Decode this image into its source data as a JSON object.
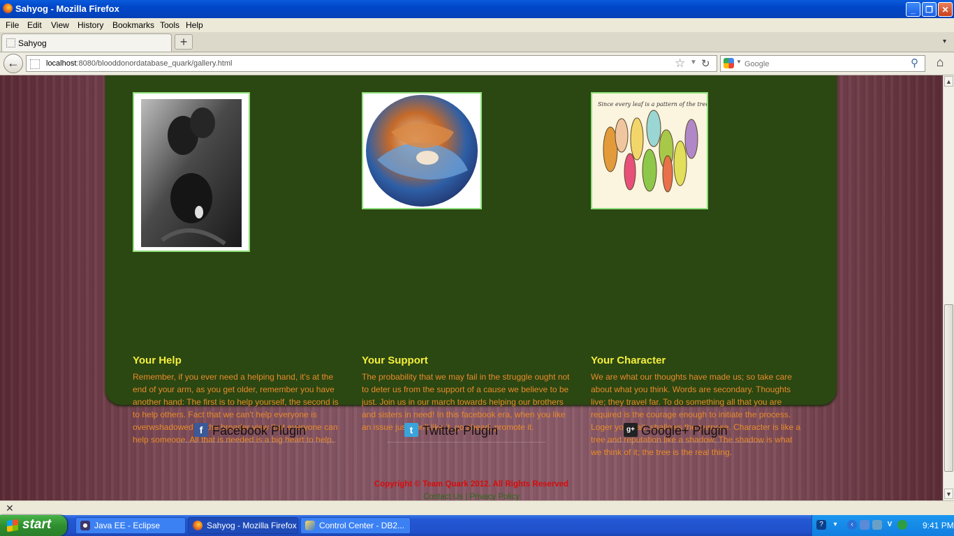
{
  "window": {
    "title": "Sahyog - Mozilla Firefox",
    "controls": {
      "minimize": "_",
      "maximize": "❐",
      "close": "✕"
    }
  },
  "menu": [
    "File",
    "Edit",
    "View",
    "History",
    "Bookmarks",
    "Tools",
    "Help"
  ],
  "tab": {
    "label": "Sahyog",
    "new_tab": "+",
    "list": "▾"
  },
  "nav": {
    "back": "←",
    "url_host": "localhost",
    "url_rest": ":8080/blooddonordatabase_quark/gallery.html",
    "search_placeholder": "Google",
    "search_icon": "magnifier-icon",
    "home_icon": "home-icon"
  },
  "page": {
    "columns": [
      {
        "heading": "Your Help",
        "image": "children-looking-up-photo",
        "text": "Remember, if you ever need a helping hand, it's at the end of your arm, as you get older, remember you have another hand: The first is to help yourself, the second is to help others. Fact that we can't help everyone is overwshadowed by the broader view that everyone can help someone. All that is needed is a big heart to help."
      },
      {
        "heading": "Your Support",
        "image": "painted-hands-globe",
        "text": "The probability that we may fail in the struggle ought not to deter us from the support of a cause we believe to be just. Join us in our march towards helping our brothers and sisters in need! In this facebook era, when you like an issue just don't like it, go ahead, promote it."
      },
      {
        "heading": "Your Character",
        "image": "painted-leaves-illustration",
        "image_caption": "Since every leaf is a pattern of the tree",
        "text": "We are what our thoughts have made us; so take care about what you think. Words are secondary. Thoughts live; they travel far. To do something all that you are required is the courage enough to initiate the process. Loger you wait; shallows the purpose. Character is like a tree and reputation like a shadow. The shadow is what we think of it; the tree is the real thing."
      }
    ],
    "plugins": [
      {
        "label": "Facebook Plugin",
        "icon": "facebook-icon",
        "glyph": "f",
        "color": "#3b5998"
      },
      {
        "label": "Twitter Plugin",
        "icon": "twitter-icon",
        "glyph": "t",
        "color": "#3aa3dc"
      },
      {
        "label": "Google+ Plugin",
        "icon": "google-plus-icon",
        "glyph": "g+",
        "color": "#222222"
      }
    ],
    "copyright": "Copyright © Team Quark 2012. All Rights Reserved",
    "footer_links": {
      "contact": "Contact Us",
      "separator": "|",
      "privacy": "Privacy Policy"
    }
  },
  "statusbar": {
    "close": "✕"
  },
  "taskbar": {
    "start": "start",
    "tasks": [
      {
        "label": "Java EE - Eclipse",
        "icon": "eclipse-icon"
      },
      {
        "label": "Sahyog - Mozilla Firefox",
        "icon": "firefox-icon"
      },
      {
        "label": "Control Center - DB2...",
        "icon": "db2-control-center-icon"
      }
    ],
    "clock": "9:41 PM"
  },
  "colors": {
    "panel": "#2b4712",
    "heading": "#f5f03c",
    "body_text": "#e88b2a",
    "copyright": "#d80c0c",
    "footer_link": "#2b6a1a"
  }
}
